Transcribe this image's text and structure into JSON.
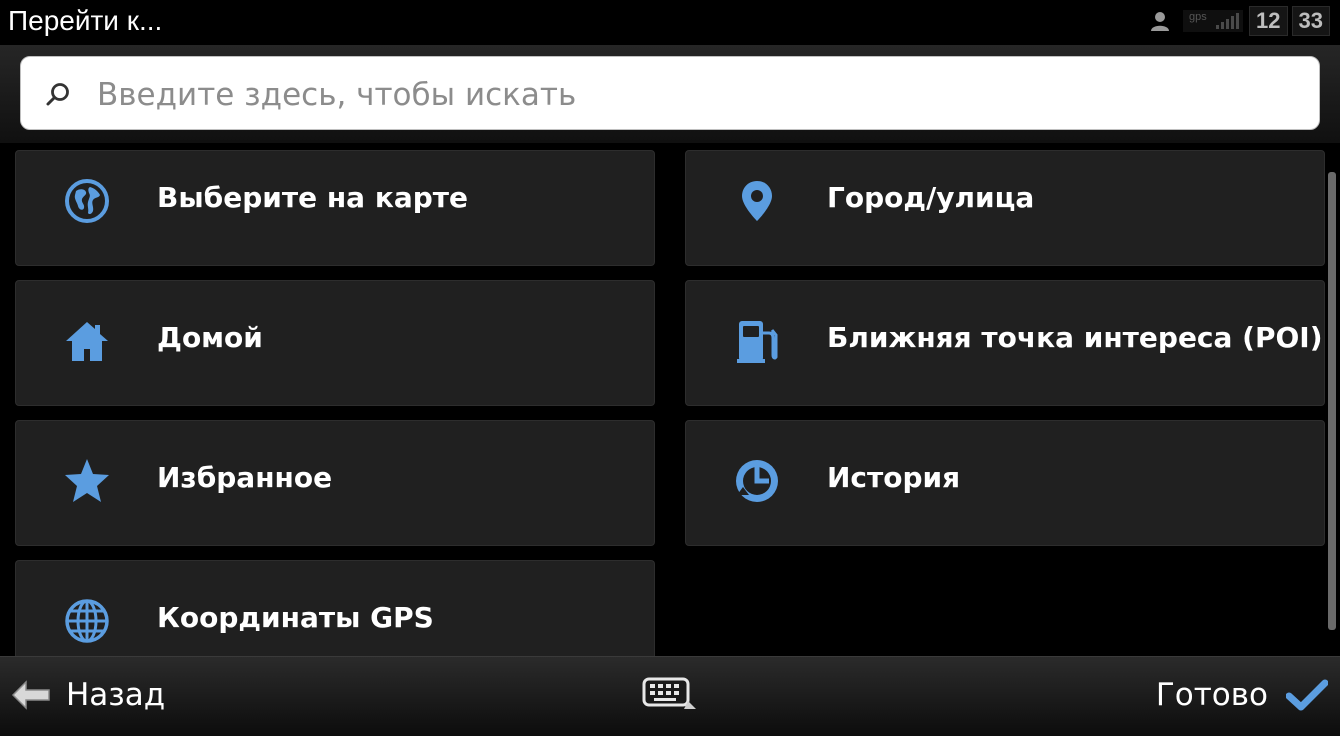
{
  "header": {
    "title": "Перейти к...",
    "status": {
      "gps_label": "gps",
      "clock_hours": "12",
      "clock_minutes": "33"
    }
  },
  "search": {
    "placeholder": "Введите здесь, чтобы искать",
    "value": ""
  },
  "menu": {
    "items": [
      {
        "label": "Выберите на карте",
        "icon": "globe-map-icon"
      },
      {
        "label": "Город/улица",
        "icon": "location-pin-icon"
      },
      {
        "label": "Домой",
        "icon": "home-icon"
      },
      {
        "label": "Ближняя точка интереса (POI)",
        "icon": "fuel-station-icon"
      },
      {
        "label": "Избранное",
        "icon": "star-icon"
      },
      {
        "label": "История",
        "icon": "history-clock-icon"
      },
      {
        "label": "Координаты GPS",
        "icon": "grid-globe-icon"
      }
    ]
  },
  "footer": {
    "back_label": "Назад",
    "done_label": "Готово",
    "keyboard_icon": "keyboard-icon"
  },
  "colors": {
    "accent": "#5b9de0",
    "tile_bg": "#202020",
    "background": "#000000",
    "text": "#ffffff"
  }
}
